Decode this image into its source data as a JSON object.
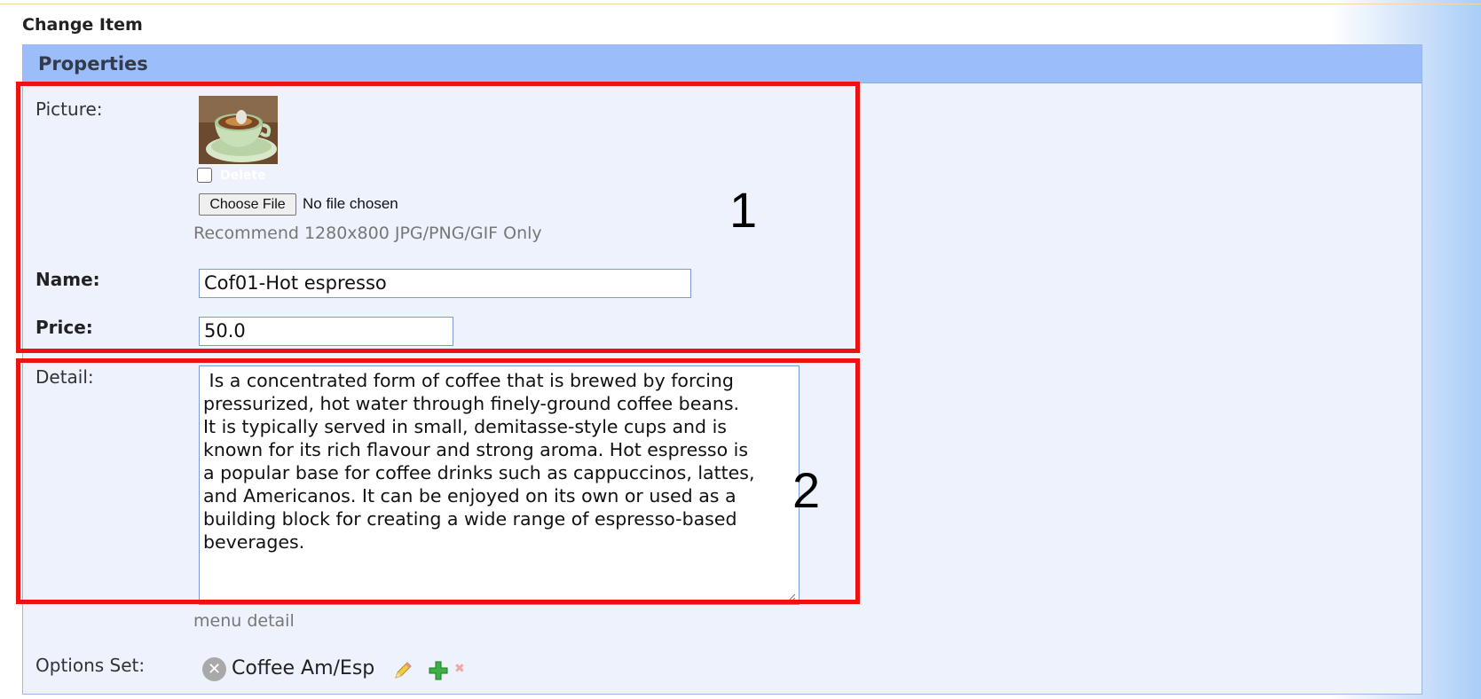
{
  "page": {
    "title": "Change Item"
  },
  "panel": {
    "header": "Properties"
  },
  "picture": {
    "label": "Picture:",
    "delete_label": "Delete",
    "choose_file_label": "Choose File",
    "file_status": "No file chosen",
    "recommend_hint": "Recommend 1280x800 JPG/PNG/GIF Only"
  },
  "name": {
    "label": "Name:",
    "value": "Cof01-Hot espresso"
  },
  "price": {
    "label": "Price:",
    "value": "50.0"
  },
  "detail": {
    "label": "Detail:",
    "value": " Is a concentrated form of coffee that is brewed by forcing\npressurized, hot water through finely-ground coffee beans.\nIt is typically served in small, demitasse-style cups and is\nknown for its rich flavour and strong aroma. Hot espresso is\na popular base for coffee drinks such as cappuccinos, lattes,\nand Americanos. It can be enjoyed on its own or used as a\nbuilding block for creating a wide range of espresso-based\nbeverages.",
    "hint": "menu detail"
  },
  "options": {
    "label": "Options Set:",
    "items": [
      {
        "name": "Coffee Am/Esp"
      }
    ]
  },
  "annotations": {
    "box1": "1",
    "box2": "2"
  },
  "colors": {
    "header_bg": "#9bbdf9",
    "panel_bg": "#edf2fc",
    "annotation_red": "#ee1111",
    "input_border": "#7a9cd3"
  },
  "icons": {
    "remove_option": "x-circle-icon",
    "edit_option": "pencil-icon",
    "add_option": "plus-icon",
    "delete_option": "small-x-icon"
  }
}
